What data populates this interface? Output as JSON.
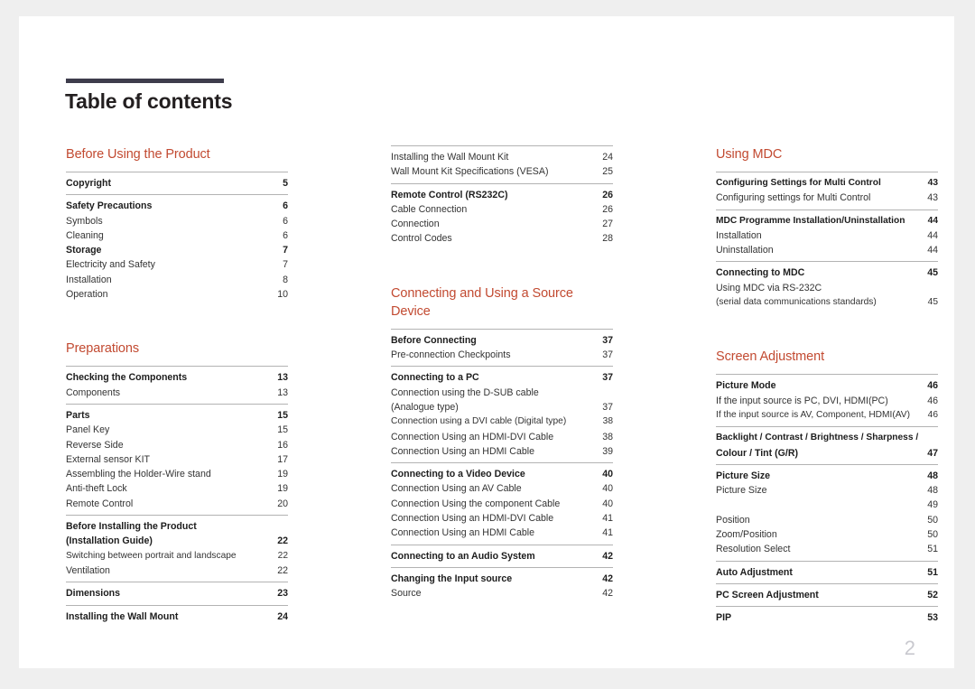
{
  "document": {
    "title": "Table of contents",
    "page_number": "2",
    "accent_color": "#c24a31",
    "rule_color": "#3e3d4c"
  },
  "columns": [
    {
      "name": "column-1",
      "sections": [
        {
          "heading": "Before Using the Product",
          "groups": [
            {
              "entries": [
                {
                  "label": "Copyright",
                  "page": "5",
                  "bold": true
                }
              ]
            },
            {
              "entries": [
                {
                  "label": "Safety Precautions",
                  "page": "6",
                  "bold": true
                },
                {
                  "label": "Symbols",
                  "page": "6",
                  "bold": false
                },
                {
                  "label": "Cleaning",
                  "page": "6",
                  "bold": false
                },
                {
                  "label": "Storage",
                  "page": "7",
                  "bold": true
                },
                {
                  "label": "Electricity and Safety",
                  "page": "7",
                  "bold": false
                },
                {
                  "label": "Installation",
                  "page": "8",
                  "bold": false
                },
                {
                  "label": "Operation",
                  "page": "10",
                  "bold": false
                }
              ]
            }
          ]
        },
        {
          "heading": "Preparations",
          "groups": [
            {
              "entries": [
                {
                  "label": "Checking the Components",
                  "page": "13",
                  "bold": true
                },
                {
                  "label": "Components",
                  "page": "13",
                  "bold": false
                }
              ]
            },
            {
              "entries": [
                {
                  "label": "Parts",
                  "page": "15",
                  "bold": true
                },
                {
                  "label": "Panel Key",
                  "page": "15",
                  "bold": false
                },
                {
                  "label": "Reverse Side",
                  "page": "16",
                  "bold": false
                },
                {
                  "label": "External sensor KIT",
                  "page": "17",
                  "bold": false
                },
                {
                  "label": "Assembling the Holder-Wire stand",
                  "page": "19",
                  "bold": false
                },
                {
                  "label": "Anti-theft Lock",
                  "page": "19",
                  "bold": false
                },
                {
                  "label": "Remote Control",
                  "page": "20",
                  "bold": false
                }
              ]
            },
            {
              "entries": [
                {
                  "label": "Before Installing the Product",
                  "page": "",
                  "bold": true
                },
                {
                  "label": "(Installation Guide)",
                  "page": "22",
                  "bold": true
                },
                {
                  "label": "Switching between portrait and landscape",
                  "page": "22",
                  "bold": false,
                  "narrow": true
                },
                {
                  "label": "Ventilation",
                  "page": "22",
                  "bold": false
                }
              ]
            },
            {
              "entries": [
                {
                  "label": "Dimensions",
                  "page": "23",
                  "bold": true
                }
              ]
            },
            {
              "entries": [
                {
                  "label": "Installing the Wall Mount",
                  "page": "24",
                  "bold": true
                }
              ]
            }
          ]
        }
      ]
    },
    {
      "name": "column-2",
      "sections": [
        {
          "heading": "",
          "groups": [
            {
              "entries": [
                {
                  "label": "Installing the Wall Mount Kit",
                  "page": "24",
                  "bold": false
                },
                {
                  "label": "Wall Mount Kit Specifications (VESA)",
                  "page": "25",
                  "bold": false
                }
              ]
            },
            {
              "entries": [
                {
                  "label": "Remote Control (RS232C)",
                  "page": "26",
                  "bold": true
                },
                {
                  "label": "Cable Connection",
                  "page": "26",
                  "bold": false
                },
                {
                  "label": "Connection",
                  "page": "27",
                  "bold": false
                },
                {
                  "label": "Control Codes",
                  "page": "28",
                  "bold": false
                }
              ]
            }
          ]
        },
        {
          "heading": "Connecting and Using a Source Device",
          "groups": [
            {
              "entries": [
                {
                  "label": "Before Connecting",
                  "page": "37",
                  "bold": true
                },
                {
                  "label": "Pre-connection Checkpoints",
                  "page": "37",
                  "bold": false
                }
              ]
            },
            {
              "entries": [
                {
                  "label": "Connecting to a PC",
                  "page": "37",
                  "bold": true
                },
                {
                  "label": "Connection using the D-SUB cable",
                  "page": "",
                  "bold": false
                },
                {
                  "label": "(Analogue type)",
                  "page": "37",
                  "bold": false
                },
                {
                  "label": "Connection using a DVI cable (Digital type)",
                  "page": "38",
                  "bold": false,
                  "narrow": true
                },
                {
                  "label": "Connection Using an HDMI-DVI Cable",
                  "page": "38",
                  "bold": false
                },
                {
                  "label": "Connection Using an HDMI Cable",
                  "page": "39",
                  "bold": false
                }
              ]
            },
            {
              "entries": [
                {
                  "label": "Connecting to a Video Device",
                  "page": "40",
                  "bold": true
                },
                {
                  "label": "Connection Using an AV Cable",
                  "page": "40",
                  "bold": false
                },
                {
                  "label": "Connection Using the component Cable",
                  "page": "40",
                  "bold": false
                },
                {
                  "label": "Connection Using an HDMI-DVI Cable",
                  "page": "41",
                  "bold": false
                },
                {
                  "label": "Connection Using an HDMI Cable",
                  "page": "41",
                  "bold": false
                }
              ]
            },
            {
              "entries": [
                {
                  "label": "Connecting to an Audio System",
                  "page": "42",
                  "bold": true
                }
              ]
            },
            {
              "entries": [
                {
                  "label": "Changing the Input source",
                  "page": "42",
                  "bold": true
                },
                {
                  "label": "Source",
                  "page": "42",
                  "bold": false
                }
              ]
            }
          ]
        }
      ]
    },
    {
      "name": "column-3",
      "sections": [
        {
          "heading": "Using MDC",
          "groups": [
            {
              "entries": [
                {
                  "label": "Configuring Settings for Multi Control",
                  "page": "43",
                  "bold": true,
                  "narrow": true
                },
                {
                  "label": "Configuring settings for Multi Control",
                  "page": "43",
                  "bold": false
                }
              ]
            },
            {
              "entries": [
                {
                  "label": "MDC Programme Installation/Uninstallation",
                  "page": "44",
                  "bold": true,
                  "narrow": true
                },
                {
                  "label": "Installation",
                  "page": "44",
                  "bold": false
                },
                {
                  "label": "Uninstallation",
                  "page": "44",
                  "bold": false
                }
              ]
            },
            {
              "entries": [
                {
                  "label": "Connecting to MDC",
                  "page": "45",
                  "bold": true
                },
                {
                  "label": "Using MDC via RS-232C",
                  "page": "",
                  "bold": false
                },
                {
                  "label": "(serial data communications standards)",
                  "page": "45",
                  "bold": false,
                  "narrow": true
                }
              ]
            }
          ]
        },
        {
          "heading": "Screen Adjustment",
          "groups": [
            {
              "entries": [
                {
                  "label": "Picture Mode",
                  "page": "46",
                  "bold": true
                },
                {
                  "label": "If the input source is PC, DVI, HDMI(PC)",
                  "page": "46",
                  "bold": false
                },
                {
                  "label": "If the input source is AV, Component, HDMI(AV)",
                  "page": "46",
                  "bold": false,
                  "narrow": true
                }
              ]
            },
            {
              "entries": [
                {
                  "label": "Backlight / Contrast / Brightness / Sharpness /",
                  "page": "",
                  "bold": true,
                  "narrow": true
                },
                {
                  "label": "Colour / Tint (G/R)",
                  "page": "47",
                  "bold": true
                }
              ]
            },
            {
              "entries": [
                {
                  "label": "Picture Size",
                  "page": "48",
                  "bold": true
                },
                {
                  "label": "Picture Size",
                  "page": "48",
                  "bold": false
                },
                {
                  "label": "",
                  "page": "49",
                  "bold": false
                },
                {
                  "label": "Position",
                  "page": "50",
                  "bold": false
                },
                {
                  "label": "Zoom/Position",
                  "page": "50",
                  "bold": false
                },
                {
                  "label": "Resolution Select",
                  "page": "51",
                  "bold": false
                }
              ]
            },
            {
              "entries": [
                {
                  "label": "Auto Adjustment",
                  "page": "51",
                  "bold": true
                }
              ]
            },
            {
              "entries": [
                {
                  "label": "PC Screen Adjustment",
                  "page": "52",
                  "bold": true
                }
              ]
            },
            {
              "entries": [
                {
                  "label": "PIP",
                  "page": "53",
                  "bold": true
                }
              ]
            }
          ]
        }
      ]
    }
  ]
}
